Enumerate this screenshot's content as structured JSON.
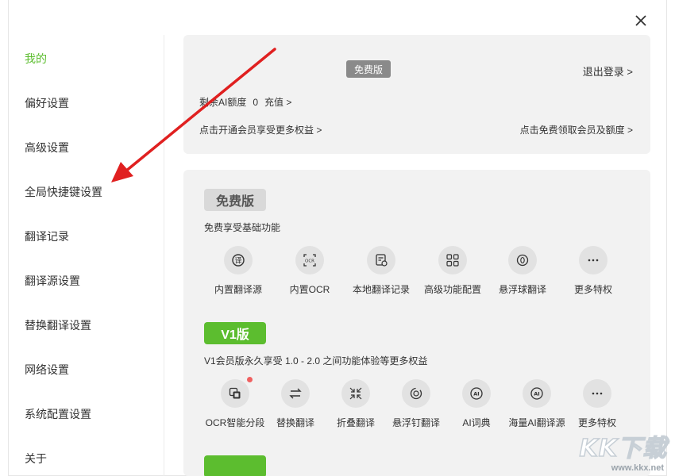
{
  "sidebar": {
    "items": [
      {
        "label": "我的",
        "active": true
      },
      {
        "label": "偏好设置"
      },
      {
        "label": "高级设置"
      },
      {
        "label": "全局快捷键设置"
      },
      {
        "label": "翻译记录"
      },
      {
        "label": "翻译源设置"
      },
      {
        "label": "替换翻译设置"
      },
      {
        "label": "网络设置"
      },
      {
        "label": "系统配置设置"
      },
      {
        "label": "关于"
      }
    ]
  },
  "account": {
    "plan_tag": "免费版",
    "logout": "退出登录 >",
    "quota_label": "剩余AI额度",
    "quota_value": "0",
    "recharge": "充值 >",
    "open_member": "点击开通会员享受更多权益 >",
    "free_member": "点击免费领取会员及额度 >"
  },
  "plans": {
    "free": {
      "badge": "免费版",
      "desc": "免费享受基础功能",
      "features": [
        {
          "label": "内置翻译源",
          "icon": "translate-icon"
        },
        {
          "label": "内置OCR",
          "icon": "ocr-icon"
        },
        {
          "label": "本地翻译记录",
          "icon": "history-icon"
        },
        {
          "label": "高级功能配置",
          "icon": "grid-icon"
        },
        {
          "label": "悬浮球翻译",
          "icon": "floating-ball-icon"
        },
        {
          "label": "更多特权",
          "icon": "more-icon"
        }
      ]
    },
    "v1": {
      "badge": "V1版",
      "desc": "V1会员版永久享受 1.0 - 2.0 之间功能体验等更多权益",
      "features": [
        {
          "label": "OCR智能分段",
          "icon": "ocr-segment-icon",
          "dot": true
        },
        {
          "label": "替换翻译",
          "icon": "swap-icon"
        },
        {
          "label": "折叠翻译",
          "icon": "collapse-icon"
        },
        {
          "label": "悬浮钉翻译",
          "icon": "pin-icon"
        },
        {
          "label": "AI词典",
          "icon": "ai-dict-icon"
        },
        {
          "label": "海量AI翻译源",
          "icon": "ai-source-icon"
        },
        {
          "label": "更多特权",
          "icon": "more-icon"
        }
      ]
    }
  },
  "watermark": {
    "logo": "KK下载",
    "url": "www.kkx.net"
  },
  "colors": {
    "accent": "#5cbd2f",
    "annotation_arrow": "#e02020"
  }
}
